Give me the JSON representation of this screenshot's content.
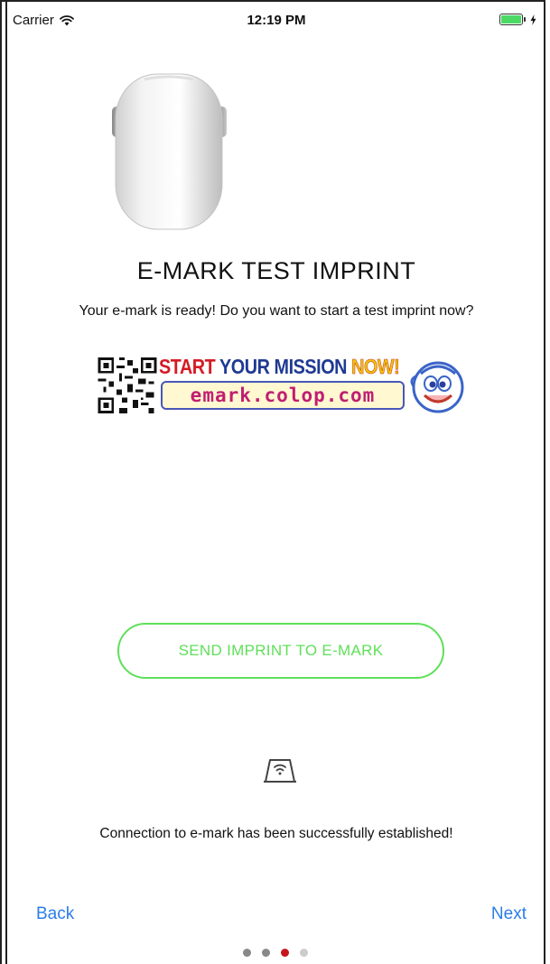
{
  "status_bar": {
    "carrier": "Carrier",
    "time": "12:19 PM"
  },
  "screen": {
    "title": "E-MARK TEST IMPRINT",
    "subtitle": "Your e-mark is ready! Do you want to start a test imprint now?"
  },
  "banner": {
    "headline_word1": "START",
    "headline_word2": "YOUR MISSION",
    "headline_word3": "NOW!",
    "url": "emark.colop.com"
  },
  "actions": {
    "send_label": "SEND IMPRINT TO E-MARK"
  },
  "connection_status": "Connection to e-mark has been successfully established!",
  "navigation": {
    "back_label": "Back",
    "next_label": "Next"
  },
  "page_indicator": {
    "total": 4,
    "current": 3
  },
  "colors": {
    "accent_green": "#5fe05a",
    "link_blue": "#2b7de9",
    "active_dot": "#c5161d"
  }
}
